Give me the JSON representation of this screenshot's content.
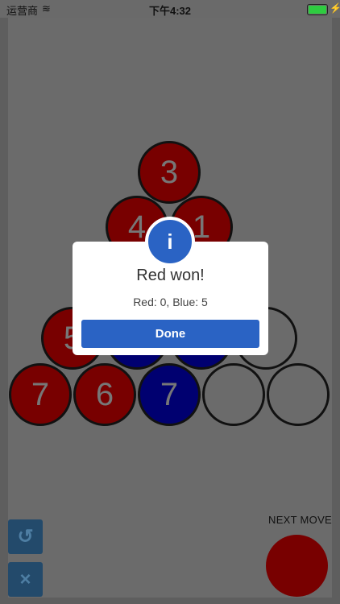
{
  "status_bar": {
    "carrier": "运营商",
    "time": "下午4:32"
  },
  "board": {
    "rows": [
      [
        {
          "color": "red",
          "value": "3"
        }
      ],
      [
        {
          "color": "red",
          "value": "4"
        },
        {
          "color": "red",
          "value": "1"
        }
      ],
      [
        {
          "color": "red",
          "value": ""
        },
        {
          "color": "red",
          "value": ""
        },
        {
          "color": "empty",
          "value": ""
        }
      ],
      [
        {
          "color": "red",
          "value": "5"
        },
        {
          "color": "blue",
          "value": ""
        },
        {
          "color": "blue",
          "value": ""
        },
        {
          "color": "empty",
          "value": ""
        }
      ],
      [
        {
          "color": "red",
          "value": "7"
        },
        {
          "color": "red",
          "value": "6"
        },
        {
          "color": "blue",
          "value": "7"
        },
        {
          "color": "empty",
          "value": ""
        },
        {
          "color": "empty",
          "value": ""
        }
      ]
    ]
  },
  "dialog": {
    "icon": "info-icon",
    "icon_glyph": "i",
    "title": "Red won!",
    "message": "Red: 0, Blue: 5",
    "button": "Done"
  },
  "controls": {
    "undo_icon": "undo-icon",
    "undo_glyph": "↺",
    "close_icon": "close-icon",
    "close_glyph": "×"
  },
  "next_move": {
    "label": "NEXT MOVE",
    "color": "red"
  }
}
